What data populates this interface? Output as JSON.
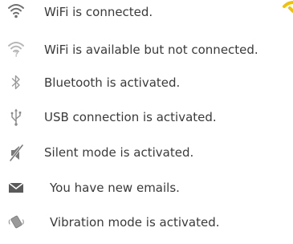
{
  "legend": {
    "items": [
      {
        "icon": "wifi-connected-icon",
        "label": "WiFi is connected."
      },
      {
        "icon": "wifi-available-icon",
        "label": "WiFi is available but not connected."
      },
      {
        "icon": "bluetooth-icon",
        "label": "Bluetooth is activated."
      },
      {
        "icon": "usb-icon",
        "label": "USB connection is activated."
      },
      {
        "icon": "silent-mode-icon",
        "label": "Silent mode is activated."
      },
      {
        "icon": "email-icon",
        "label": "You have new emails."
      },
      {
        "icon": "vibration-icon",
        "label": "Vibration mode is activated."
      }
    ]
  },
  "colors": {
    "text": "#3a3a3a",
    "icon_dark": "#6f6f6f",
    "icon_light": "#b7b7b7",
    "accent_corner": "#f2c200"
  }
}
